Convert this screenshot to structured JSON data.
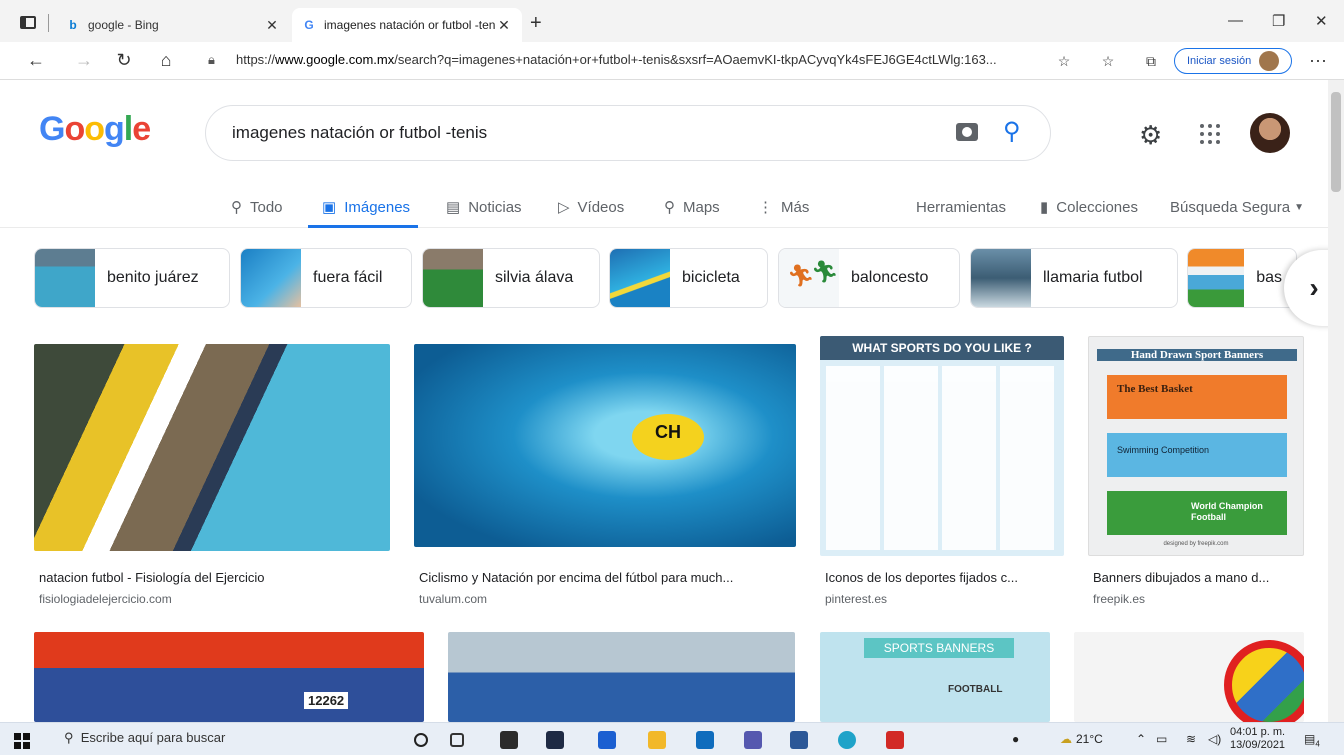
{
  "browser": {
    "tabs": [
      {
        "title": "google - Bing",
        "icon": "bing-icon"
      },
      {
        "title": "imagenes natación or futbol -ten",
        "icon": "google-icon"
      }
    ],
    "url_prefix": "https://",
    "url_host": "www.google.com.mx",
    "url_rest": "/search?q=imagenes+natación+or+futbol+-tenis&sxsrf=AOaemvKI-tkpACyvqYk4sFEJ6GE4ctLWlg:163...",
    "signin_label": "Iniciar sesión"
  },
  "google": {
    "query": "imagenes natación or futbol -tenis",
    "tabs": [
      {
        "label": "Todo",
        "icon": "search-icon"
      },
      {
        "label": "Imágenes",
        "icon": "image-icon"
      },
      {
        "label": "Noticias",
        "icon": "news-icon"
      },
      {
        "label": "Vídeos",
        "icon": "video-icon"
      },
      {
        "label": "Maps",
        "icon": "map-pin-icon"
      },
      {
        "label": "Más",
        "icon": "more-icon"
      }
    ],
    "tools_label": "Herramientas",
    "collections_label": "Colecciones",
    "safesearch_label": "Búsqueda Segura"
  },
  "chips": [
    {
      "label": "benito juárez"
    },
    {
      "label": "fuera fácil"
    },
    {
      "label": "silvia álava"
    },
    {
      "label": "bicicleta"
    },
    {
      "label": "baloncesto"
    },
    {
      "label": "llamaria futbol"
    },
    {
      "label": "bas"
    }
  ],
  "results": [
    {
      "caption": "natacion futbol - Fisiología del Ejercicio",
      "source": "fisiologiadelejercicio.com"
    },
    {
      "caption": "Ciclismo y Natación por encima del fútbol para much...",
      "source": "tuvalum.com"
    },
    {
      "caption": "Iconos de los deportes fijados c...",
      "source": "pinterest.es"
    },
    {
      "caption": "Banners dibujados a mano d...",
      "source": "freepik.es"
    }
  ],
  "image_text": {
    "what_sports": "WHAT SPORTS DO YOU LIKE ?",
    "banner_title": "Hand Drawn Sport Banners",
    "banner1": "The Best Basket",
    "banner2": "Swimming Competition",
    "banner3": "World Champion Football",
    "banner_credit": "designed by freepik.com",
    "sports_banners": "SPORTS BANNERS",
    "football": "FOOTBALL",
    "swim_cap": "CH",
    "number": "12262"
  },
  "taskbar": {
    "search_placeholder": "Escribe aquí para buscar",
    "temperature": "21°C",
    "time": "04:01 p. m.",
    "date": "13/09/2021",
    "notifications": "4"
  }
}
